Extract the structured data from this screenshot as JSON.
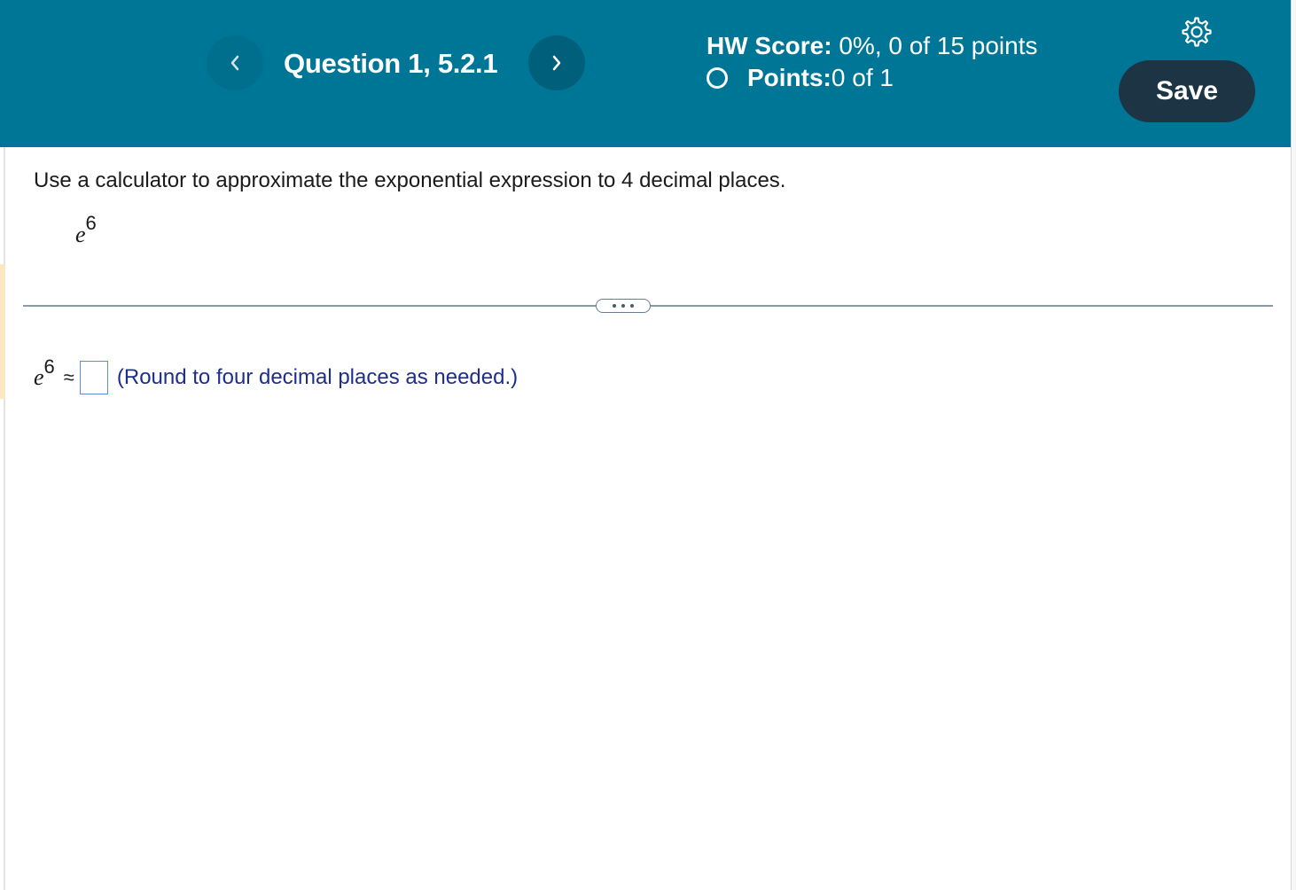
{
  "header": {
    "question_title": "Question 1, 5.2.1",
    "hw_score_label": "HW Score:",
    "hw_score_value": " 0%, 0 of 15 points",
    "points_label": "Points:",
    "points_value": " 0 of 1",
    "save_label": "Save",
    "prev_icon": "chevron-left-icon",
    "next_icon": "chevron-right-icon",
    "settings_icon": "gear-icon"
  },
  "question": {
    "instruction": "Use a calculator to approximate the exponential expression to 4 decimal places.",
    "expression_base": "e",
    "expression_exponent": "6"
  },
  "answer": {
    "lhs_base": "e",
    "lhs_exponent": "6",
    "relation": "≈",
    "value": "",
    "hint": "(Round to four decimal places as needed.)"
  },
  "colors": {
    "header_bg": "#007696",
    "save_bg": "#1d3444",
    "hint_text": "#1d2e8c",
    "input_border": "#5b8fd6"
  }
}
